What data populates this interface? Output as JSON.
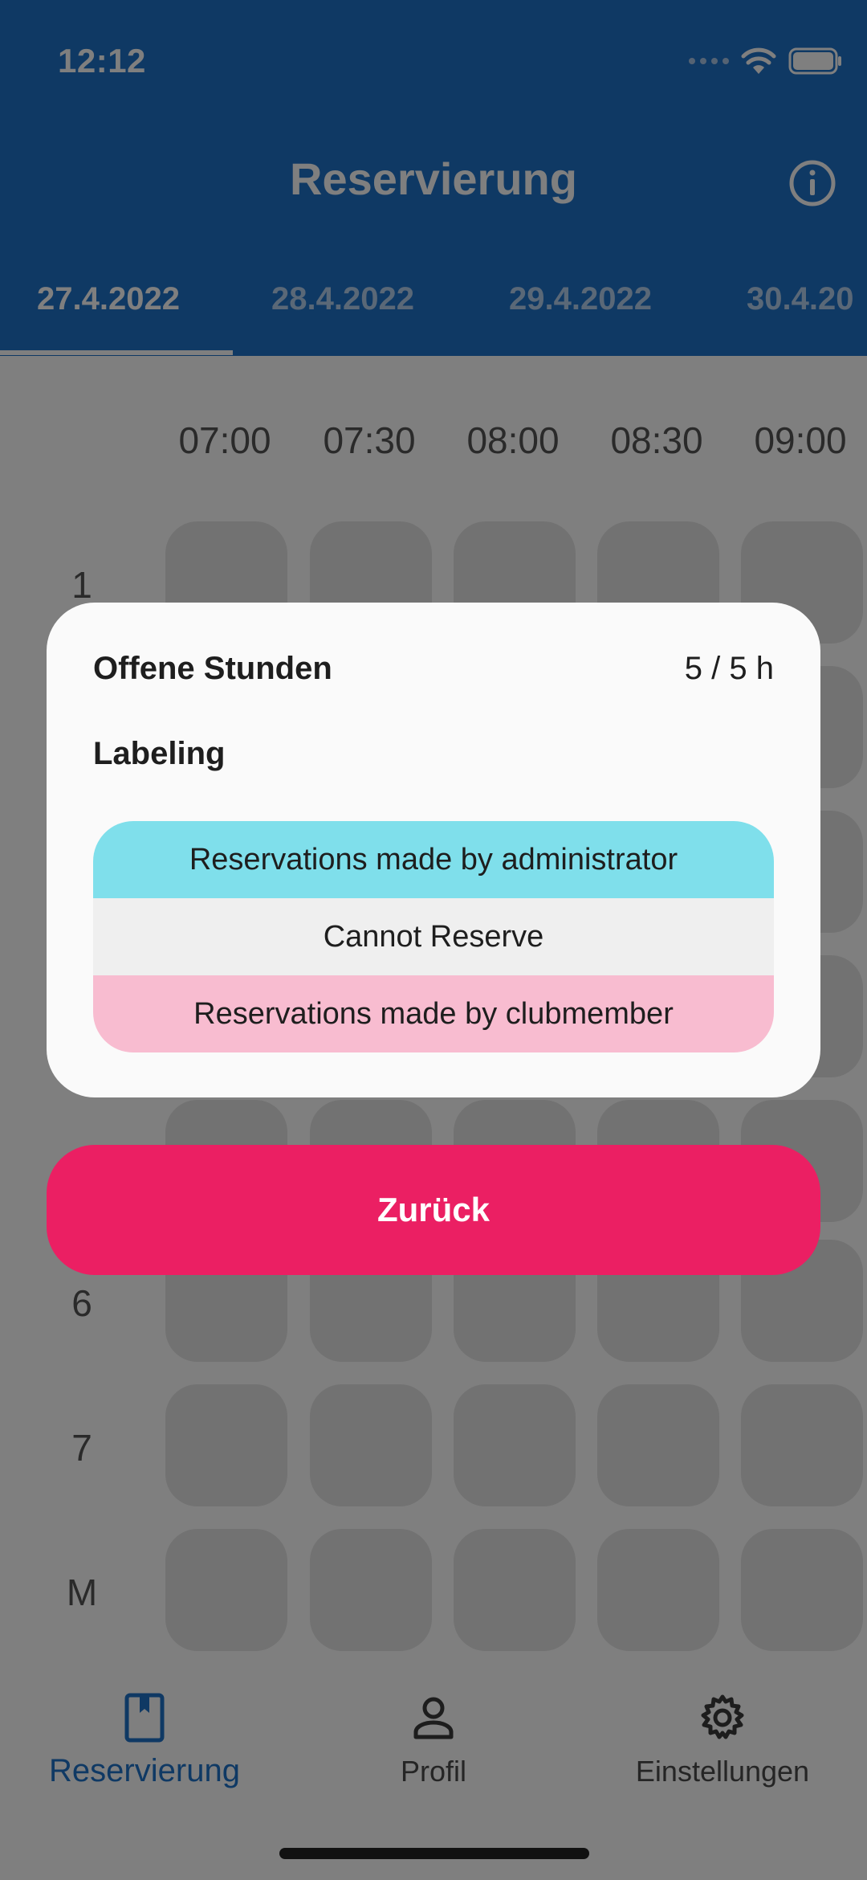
{
  "status_bar": {
    "time": "12:12"
  },
  "header": {
    "title": "Reservierung",
    "info_icon": "info-icon"
  },
  "tabs": [
    {
      "label": "27.4.2022",
      "active": true
    },
    {
      "label": "28.4.2022",
      "active": false
    },
    {
      "label": "29.4.2022",
      "active": false
    },
    {
      "label": "30.4.20",
      "active": false
    }
  ],
  "grid": {
    "times": [
      "07:00",
      "07:30",
      "08:00",
      "08:30",
      "09:00"
    ],
    "rows": [
      "1",
      "6",
      "7",
      "M"
    ]
  },
  "dialog": {
    "title": "Offene Stunden",
    "hours": "5 / 5 h",
    "section_title": "Labeling",
    "legend": [
      {
        "label": "Reservations made by administrator",
        "color": "#7fdfeb"
      },
      {
        "label": "Cannot Reserve",
        "color": "#efefef"
      },
      {
        "label": "Reservations made by clubmember",
        "color": "#f8bcd0"
      }
    ]
  },
  "back_button": {
    "label": "Zurück"
  },
  "bottom_nav": [
    {
      "label": "Reservierung",
      "icon": "book-icon",
      "active": true
    },
    {
      "label": "Profil",
      "icon": "person-icon",
      "active": false
    },
    {
      "label": "Einstellungen",
      "icon": "gear-icon",
      "active": false
    }
  ],
  "colors": {
    "primary": "#1f72c9",
    "accent": "#eb1f63"
  }
}
